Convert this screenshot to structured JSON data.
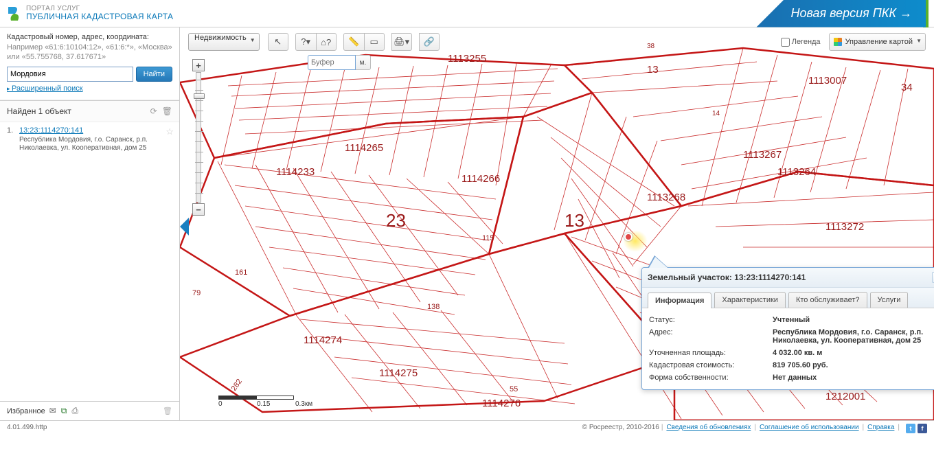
{
  "header": {
    "portal": "ПОРТАЛ УСЛУГ",
    "title": "ПУБЛИЧНАЯ КАДАСТРОВАЯ КАРТА",
    "new_version": "Новая версия ПКК →"
  },
  "search": {
    "label": "Кадастровый номер, адрес, координата:",
    "hint": "Например «61:6:10104:12», «61:6:*», «Москва» или «55.755768, 37.617671»",
    "value": "Мордовия",
    "button": "Найти",
    "advanced": "Расширенный поиск"
  },
  "results": {
    "header": "Найден 1 объект",
    "item": {
      "num": "1.",
      "link": "13:23:1114270:141",
      "address": "Республика Мордовия, г.о. Саранск, р.п. Николаевка, ул. Кооперативная, дом 25"
    }
  },
  "favorites": {
    "label": "Избранное"
  },
  "toolbar": {
    "layer_select": "Недвижимость",
    "buffer_placeholder": "Буфер",
    "buffer_unit": "м.",
    "legend": "Легенда",
    "manage": "Управление картой"
  },
  "scale": {
    "l0": "0",
    "l1": "0.15",
    "l2": "0.3км"
  },
  "map_labels": {
    "l_1113255": "1113255",
    "l_13_small": "13",
    "l_1113007": "1113007",
    "l_34": "34",
    "l_1114265": "1114265",
    "l_1113267": "1113267",
    "l_1113264": "1113264",
    "l_1114233": "1114233",
    "l_1114266": "1114266",
    "l_1113268": "1113268",
    "l_23": "23",
    "l_13_big": "13",
    "l_1113272": "1113272",
    "l_115": "115",
    "l_161": "161",
    "l_79": "79",
    "l_138": "138",
    "l_1114274": "1114274",
    "l_1114275": "1114275",
    "l_55": "55",
    "l_1114276": "1114276",
    "l_1212001": "1212001",
    "l_282": "282",
    "l_14": "14",
    "l_38": "38"
  },
  "popup": {
    "title_prefix": "Земельный участок: ",
    "title_id": "13:23:1114270:141",
    "tabs": {
      "info": "Информация",
      "char": "Характеристики",
      "serve": "Кто обслуживает?",
      "svc": "Услуги"
    },
    "rows": {
      "status_l": "Статус:",
      "status_v": "Учтенный",
      "addr_l": "Адрес:",
      "addr_v": "Республика Мордовия, г.о. Саранск, р.п. Николаевка, ул. Кооперативная, дом 25",
      "area_l": "Уточненная площадь:",
      "area_v": "4 032.00 кв. м",
      "cost_l": "Кадастровая стоимость:",
      "cost_v": "819 705.60 руб.",
      "own_l": "Форма собственности:",
      "own_v": "Нет данных"
    }
  },
  "footer": {
    "left": "4.01.499.http",
    "copy": "© Росреестр, 2010-2016",
    "updates": "Сведения об обновлениях",
    "agreement": "Соглашение об использовании",
    "help": "Справка"
  }
}
